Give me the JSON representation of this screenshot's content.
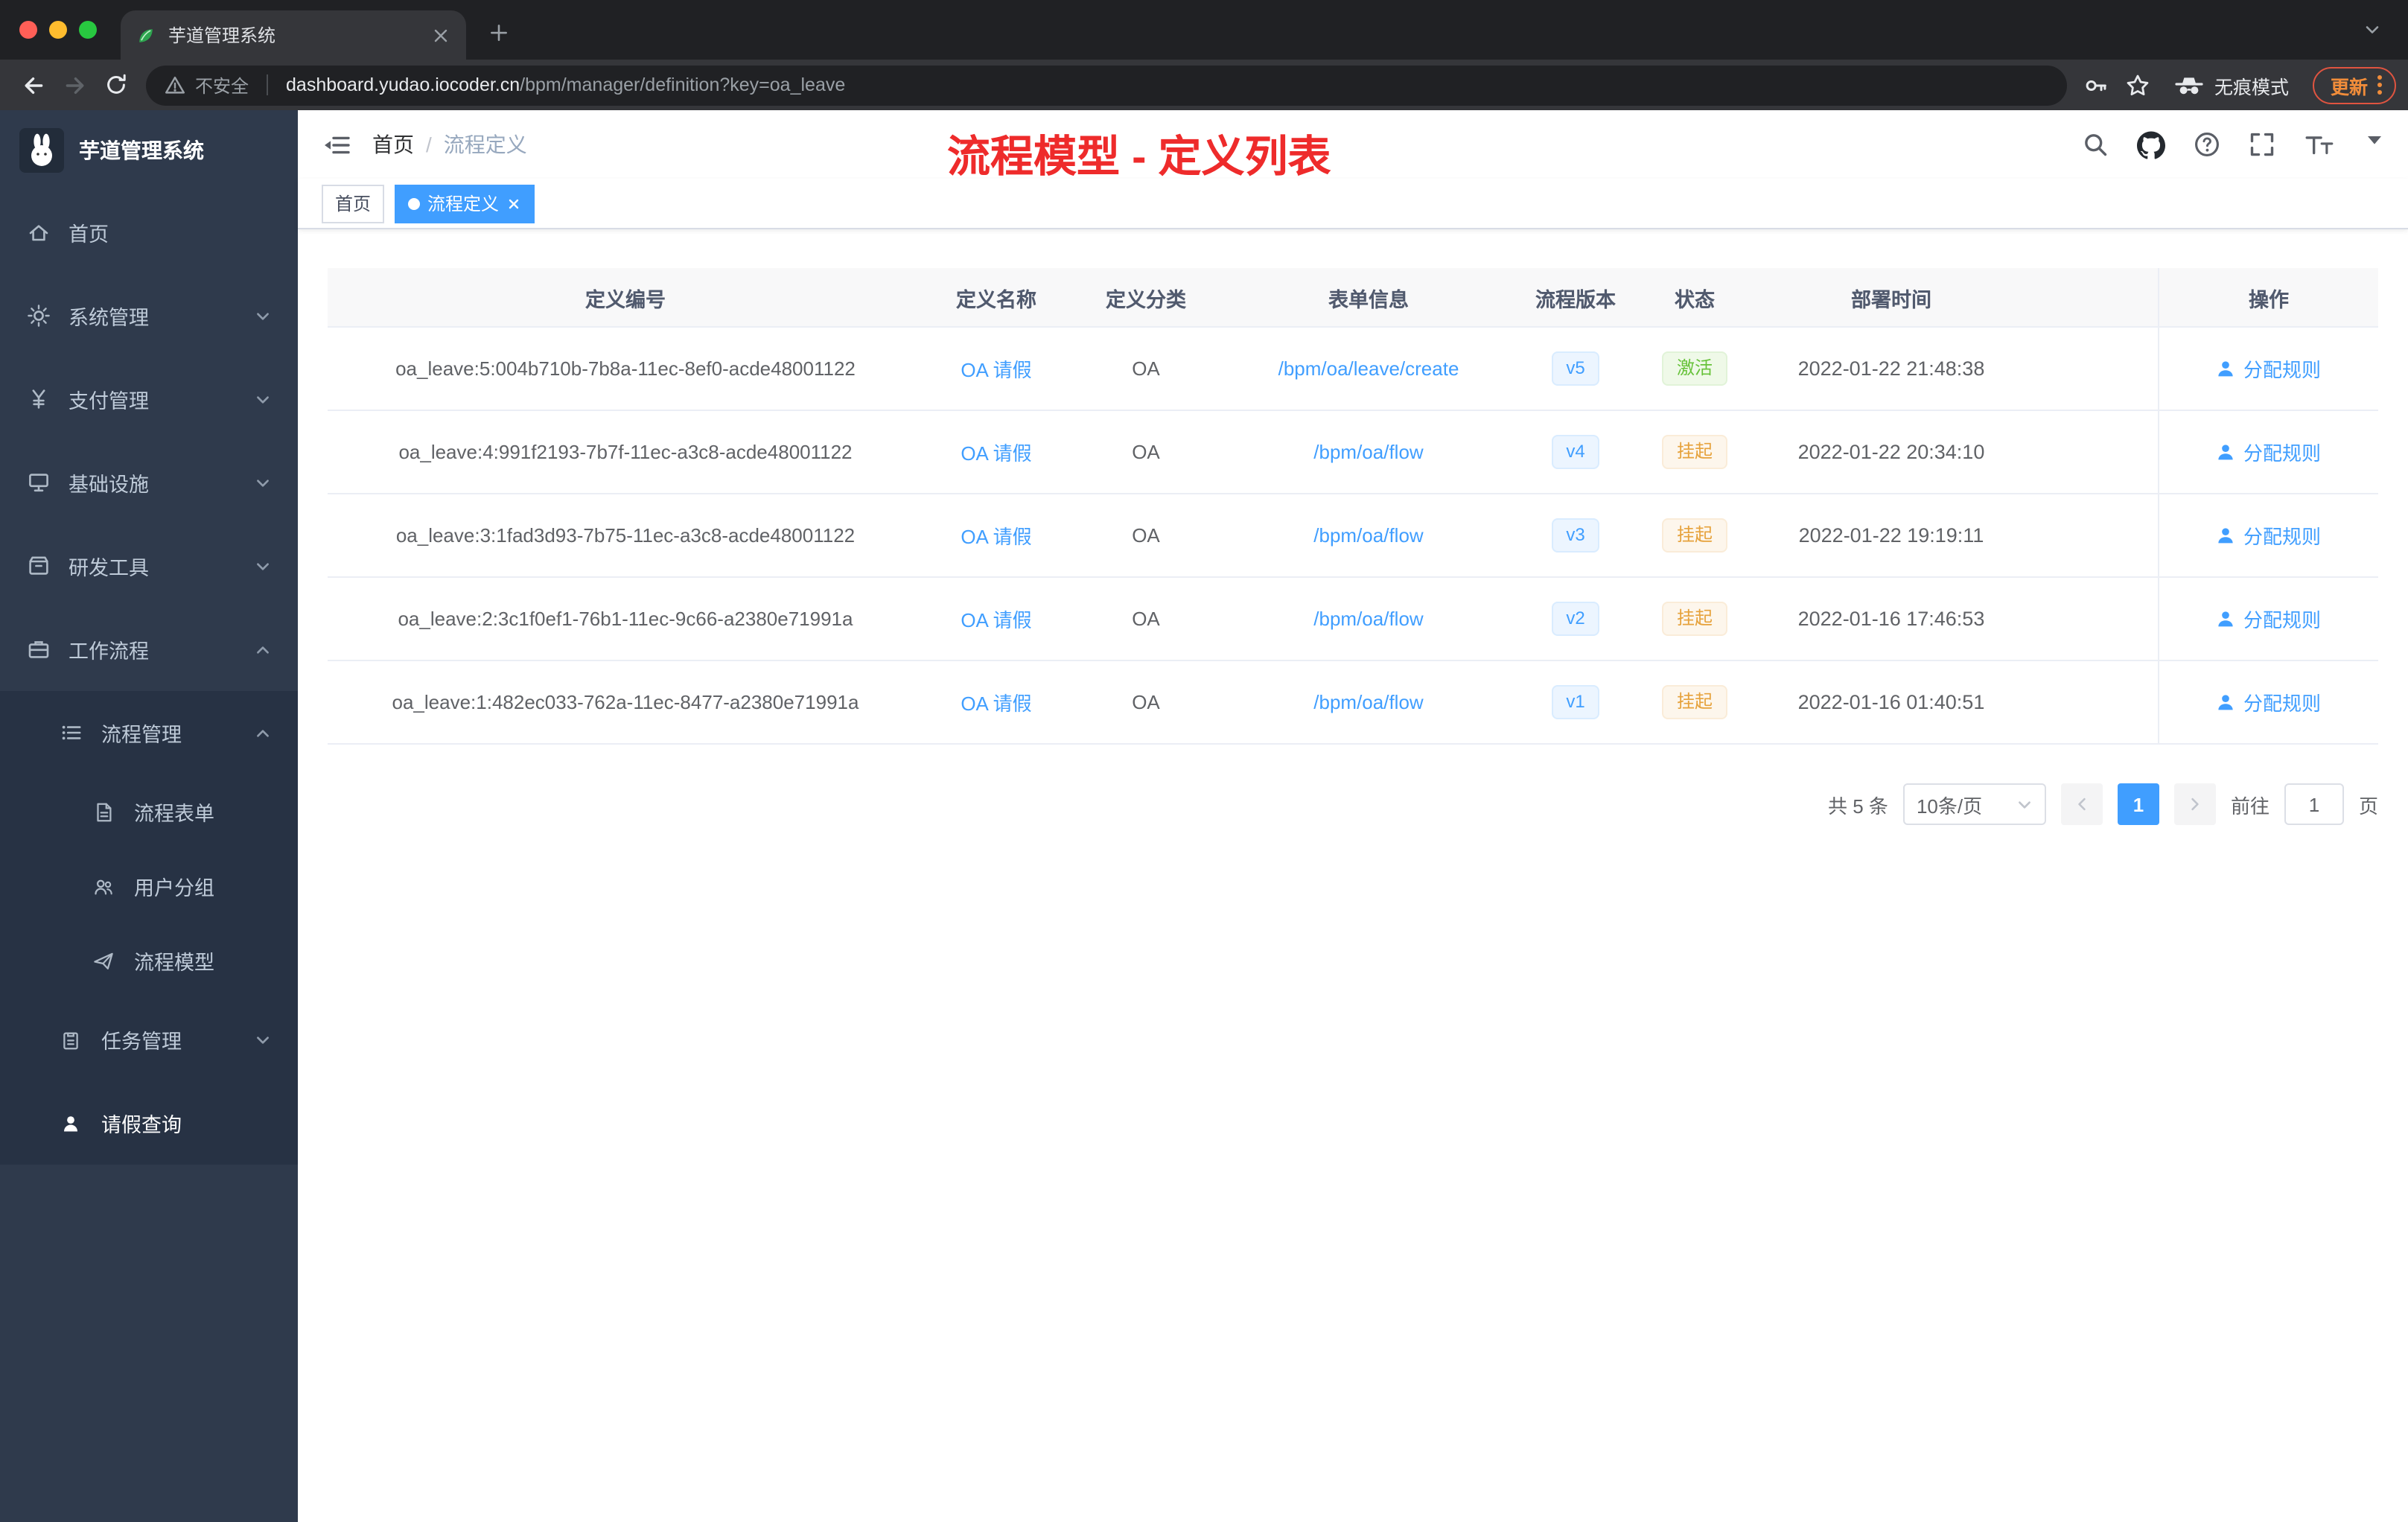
{
  "browser": {
    "tab_title": "芋道管理系统",
    "security_label": "不安全",
    "url_host": "dashboard.yudao.iocoder.cn",
    "url_path": "/bpm/manager/definition?key=oa_leave",
    "incognito_label": "无痕模式",
    "update_label": "更新"
  },
  "sidebar": {
    "logo_title": "芋道管理系统",
    "items": [
      {
        "label": "首页"
      },
      {
        "label": "系统管理"
      },
      {
        "label": "支付管理"
      },
      {
        "label": "基础设施"
      },
      {
        "label": "研发工具"
      },
      {
        "label": "工作流程"
      }
    ],
    "submenu": {
      "process_mgmt": "流程管理",
      "process_form": "流程表单",
      "user_group": "用户分组",
      "process_model": "流程模型",
      "task_mgmt": "任务管理",
      "leave_query": "请假查询"
    }
  },
  "navbar": {
    "breadcrumb_home": "首页",
    "breadcrumb_sep": "/",
    "breadcrumb_current": "流程定义",
    "annotation": "流程模型 - 定义列表"
  },
  "tags": {
    "home": "首页",
    "current": "流程定义"
  },
  "table": {
    "columns": {
      "id": "定义编号",
      "name": "定义名称",
      "category": "定义分类",
      "form": "表单信息",
      "version": "流程版本",
      "status": "状态",
      "deploy_time": "部署时间",
      "actions": "操作"
    },
    "action_label": "分配规则",
    "rows": [
      {
        "id": "oa_leave:5:004b710b-7b8a-11ec-8ef0-acde48001122",
        "name": "OA 请假",
        "category": "OA",
        "form": "/bpm/oa/leave/create",
        "version": "v5",
        "status": "激活",
        "deploy_time": "2022-01-22 21:48:38"
      },
      {
        "id": "oa_leave:4:991f2193-7b7f-11ec-a3c8-acde48001122",
        "name": "OA 请假",
        "category": "OA",
        "form": "/bpm/oa/flow",
        "version": "v4",
        "status": "挂起",
        "deploy_time": "2022-01-22 20:34:10"
      },
      {
        "id": "oa_leave:3:1fad3d93-7b75-11ec-a3c8-acde48001122",
        "name": "OA 请假",
        "category": "OA",
        "form": "/bpm/oa/flow",
        "version": "v3",
        "status": "挂起",
        "deploy_time": "2022-01-22 19:19:11"
      },
      {
        "id": "oa_leave:2:3c1f0ef1-76b1-11ec-9c66-a2380e71991a",
        "name": "OA 请假",
        "category": "OA",
        "form": "/bpm/oa/flow",
        "version": "v2",
        "status": "挂起",
        "deploy_time": "2022-01-16 17:46:53"
      },
      {
        "id": "oa_leave:1:482ec033-762a-11ec-8477-a2380e71991a",
        "name": "OA 请假",
        "category": "OA",
        "form": "/bpm/oa/flow",
        "version": "v1",
        "status": "挂起",
        "deploy_time": "2022-01-16 01:40:51"
      }
    ]
  },
  "pagination": {
    "total": "共 5 条",
    "page_size": "10条/页",
    "page": "1",
    "goto": "前往",
    "goto_value": "1",
    "unit": "页"
  },
  "colors": {
    "accent": "#409eff",
    "success": "#67c23a",
    "warning": "#e6a23c",
    "annotation_red": "#ee2b2b",
    "sidebar_bg": "#2f3a4c"
  }
}
